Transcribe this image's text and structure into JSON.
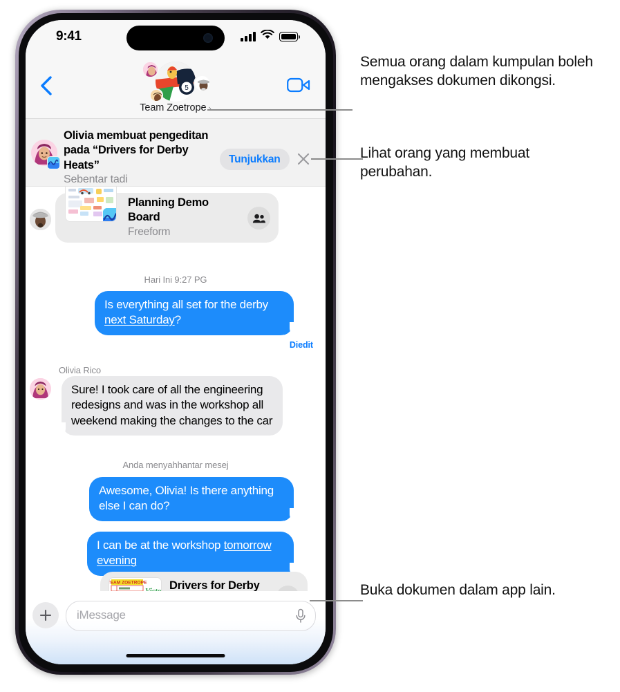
{
  "status_bar": {
    "time": "9:41",
    "cellular_icon": "signal-bars-icon",
    "wifi_icon": "wifi-icon",
    "battery_icon": "battery-icon"
  },
  "nav_bar": {
    "back_icon": "chevron-left-icon",
    "video_icon": "facetime-video-icon",
    "group_name": "Team Zoetrope",
    "group_chevron": "›",
    "group_avatar_badge": "5"
  },
  "notification": {
    "title": "Olivia membuat pengeditan pada “Drivers for Derby Heats”",
    "subtitle": "Sebentar tadi",
    "show_button": "Tunjukkan",
    "close_icon": "close-x-icon",
    "avatar": "olivia-memoji-avatar",
    "app_badge": "freeform-app-icon"
  },
  "conversation": {
    "freeform_card": {
      "title": "Planning Demo Board",
      "subtitle": "Freeform",
      "people_icon": "shared-with-people-icon",
      "thumbnail": "planning-board-thumbnail",
      "app_badge": "freeform-app-icon",
      "sender_avatar": "teammate-memoji-avatar"
    },
    "timestamp": "Hari Ini 9:27 PG",
    "messages": [
      {
        "side": "sent",
        "text_plain": "Is everything all set for the derby ",
        "text_link": "next Saturday",
        "text_tail": "?",
        "edited_label": "Diedit"
      },
      {
        "side": "received",
        "sender": "Olivia Rico",
        "text": "Sure! I took care of all the engineering redesigns and was in the workshop all weekend making the changes to the car",
        "avatar": "olivia-memoji-avatar"
      },
      {
        "side": "sent",
        "text": "Awesome, Olivia! Is there anything else I can do?"
      },
      {
        "side": "sent",
        "text_plain": "I can be at the workshop ",
        "text_link": "tomorrow evening"
      }
    ],
    "status_label": "Anda menyahhantar mesej",
    "doc_card": {
      "title": "Drivers for Derby Heats",
      "people_icon": "shared-with-people-icon",
      "thumbnail": "drivers-for-derby-heats-thumbnail",
      "thumbnail_header": "TEAM ZOETROPE",
      "thumbnail_word": "Victory!"
    }
  },
  "input_bar": {
    "plus_icon": "plus-icon",
    "placeholder": "iMessage",
    "mic_icon": "microphone-icon"
  },
  "callouts": [
    {
      "id": "callout-share-access",
      "text": "Semua orang dalam kumpulan boleh mengakses dokumen dikongsi."
    },
    {
      "id": "callout-see-who-changed",
      "text": "Lihat orang yang membuat perubahan."
    },
    {
      "id": "callout-open-in-other-app",
      "text": "Buka dokumen dalam app lain."
    }
  ],
  "colors": {
    "imessage_blue": "#1d8cfb",
    "accent_blue": "#0a7cff",
    "received_gray": "#e9e9eb",
    "banner_gray": "#f2f2f2",
    "secondary_text": "#8a8a8e"
  }
}
